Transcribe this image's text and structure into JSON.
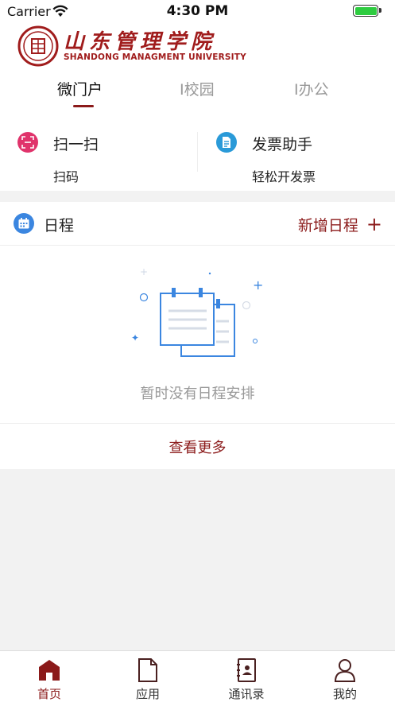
{
  "status_bar": {
    "carrier": "Carrier",
    "time": "4:30 PM",
    "battery_level": 1.0
  },
  "header": {
    "logo": {
      "name_cn": "山东管理学院",
      "name_en": "SHANDONG MANAGMENT UNIVERSITY"
    },
    "tabs": [
      {
        "label": "微门户",
        "active": true
      },
      {
        "label": "I校园",
        "active": false
      },
      {
        "label": "I办公",
        "active": false
      }
    ]
  },
  "quick_actions": [
    {
      "title": "扫一扫",
      "subtitle": "扫码",
      "icon": "scan-icon",
      "color": "#e0336b"
    },
    {
      "title": "发票助手",
      "subtitle": "轻松开发票",
      "icon": "invoice-icon",
      "color": "#2a9ad8"
    }
  ],
  "schedule": {
    "title": "日程",
    "add_label": "新增日程",
    "add_icon": "plus-icon",
    "empty_text": "暂时没有日程安排",
    "more_label": "查看更多"
  },
  "tabbar": {
    "items": [
      {
        "label": "首页",
        "icon": "home-icon",
        "active": true
      },
      {
        "label": "应用",
        "icon": "document-icon",
        "active": false
      },
      {
        "label": "通讯录",
        "icon": "contacts-icon",
        "active": false
      },
      {
        "label": "我的",
        "icon": "profile-icon",
        "active": false
      }
    ]
  },
  "colors": {
    "brand": "#8b1a1a",
    "scan": "#e0336b",
    "invoice": "#2a9ad8",
    "schedule": "#3b86e0"
  }
}
